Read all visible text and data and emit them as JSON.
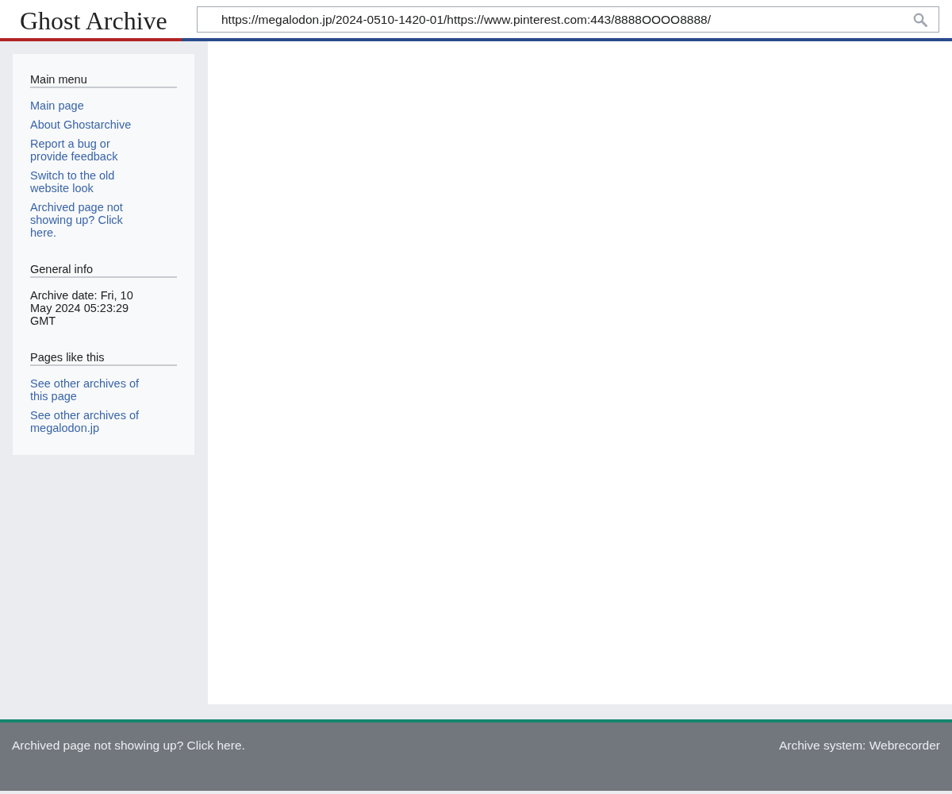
{
  "header": {
    "logo": "Ghost Archive",
    "search": {
      "value": "https://megalodon.jp/2024-0510-1420-01/https://www.pinterest.com:443/8888OOOO8888/"
    }
  },
  "sidebar": {
    "sections": [
      {
        "kind": "links",
        "heading": "Main menu",
        "items": [
          "Main page",
          "About Ghostarchive",
          "Report a bug or provide feedback",
          "Switch to the old website look",
          "Archived page not showing up? Click here."
        ]
      },
      {
        "kind": "text",
        "heading": "General info",
        "text": "Archive date: Fri, 10 May 2024 05:23:29 GMT"
      },
      {
        "kind": "links",
        "heading": "Pages like this",
        "items": [
          "See other archives of this page",
          "See other archives of megalodon.jp"
        ]
      }
    ]
  },
  "footer": {
    "link": "Archived page not showing up? Click here.",
    "system": "Archive system: Webrecorder"
  }
}
